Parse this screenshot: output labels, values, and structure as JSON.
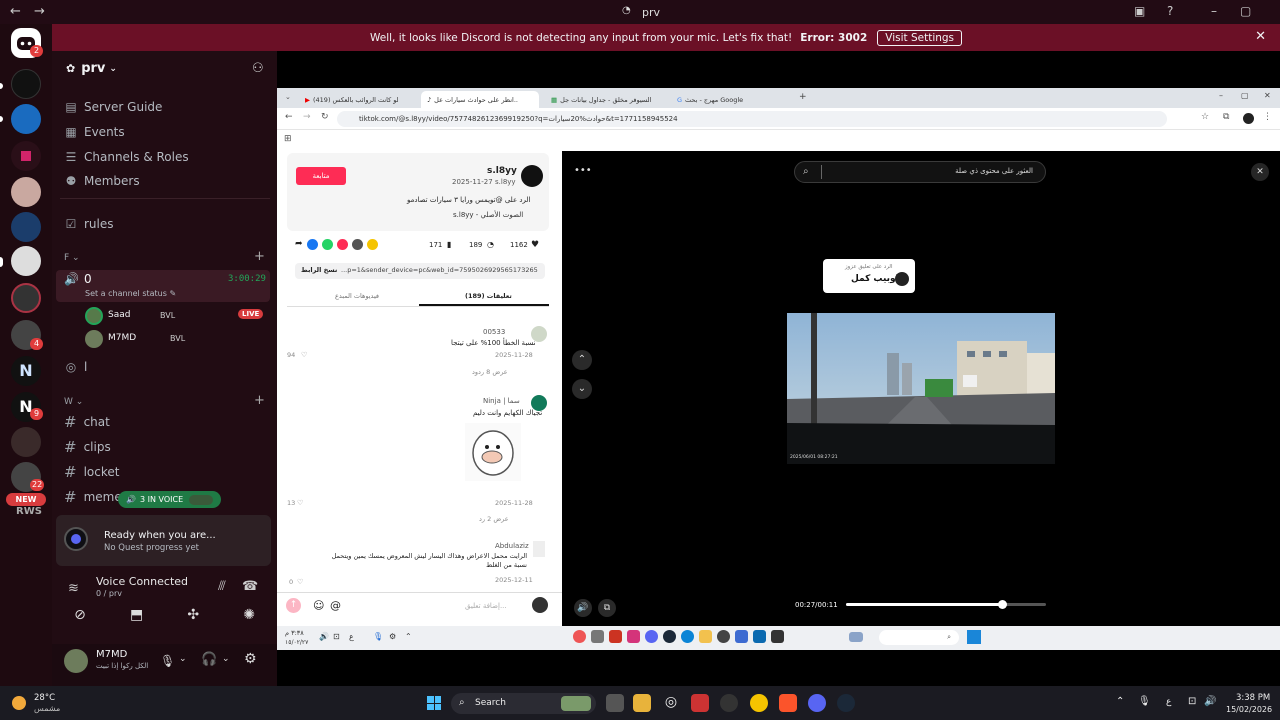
{
  "window": {
    "title": "prv"
  },
  "banner": {
    "text": "Well, it looks like Discord is not detecting any input from your mic. Let's fix that!",
    "error": "Error: 3002",
    "button": "Visit Settings"
  },
  "servers": {
    "home_badge": "2",
    "badges": [
      "4",
      "9",
      "22"
    ],
    "new_label": "NEW",
    "rws": "RWS"
  },
  "server": {
    "name": "prv"
  },
  "nav": [
    "Server Guide",
    "Events",
    "Channels & Roles",
    "Members"
  ],
  "channels": {
    "rules": "rules",
    "cat_f": "F",
    "voice": {
      "name": "0",
      "timer": "3:00:29",
      "status": "Set a channel status",
      "users": [
        {
          "name": "Saad",
          "tag": "BVL",
          "live": "LIVE"
        },
        {
          "name": "M7MD",
          "tag": "BVL"
        }
      ]
    },
    "voice2": "l",
    "cat_w": "W",
    "text": [
      "chat",
      "clips",
      "locket",
      "meme"
    ],
    "in_voice": "3 IN VOICE"
  },
  "quest": {
    "title": "Ready when you are...",
    "sub": "No Quest progress yet"
  },
  "voice_conn": {
    "title": "Voice Connected",
    "sub": "0 / prv"
  },
  "user": {
    "name": "M7MD",
    "status": "الكل ركوا إذا تبيت"
  },
  "browser": {
    "tabs": [
      "(419) لو كانت الروائب بالعكس",
      "انظر على حوادث سيارات عل..",
      "السيوفر مخلق - جداول بيانات جل",
      "مهرج - بحث Google"
    ],
    "url": "tiktok.com/@s.l8yy/video/7577482612369919250?q=حوادث%20سيارات&t=1771158945524"
  },
  "tiktok": {
    "user": "s.l8yy",
    "handle": "s.l8yy",
    "date": "2025-11-27",
    "follow": "متابعة",
    "desc": "الرد على @تويمس ورايا ٣ سيارات تصادمو",
    "sound": "الصوت الأصلي - s.l8yy",
    "likes": "1162",
    "comments_n": "189",
    "saves": "171",
    "link": "...p=1&sender_device=pc&web_id=7595026929565173265",
    "copy": "نسخ الرابط",
    "tab_comments": "تعليقات (189)",
    "tab_creator": "فيديوهات المبدع",
    "comments": [
      {
        "user": "00533",
        "text": "نسبة الخطأ 100% على تيتجا",
        "date": "2025-11-28",
        "likes": "94",
        "replies": "عرض 8 ردود"
      },
      {
        "user": "Ninja | سما",
        "text": "تجياك الكهايم وانت دليم",
        "date": "2025-11-28",
        "likes": "13",
        "replies": "عرض 2 رد"
      },
      {
        "user": "Abdulaziz",
        "text": "الرايت محمل الاعراض وهذاك اليسار ليش المعروض يمسك يمين ويتحمل نسبة من الغلط",
        "date": "2025-12-11",
        "likes": "0"
      }
    ],
    "input_placeholder": "إضافة تعليق..."
  },
  "player": {
    "search": "العثور على محتوى ذي صلة",
    "reply_label": "الرد على تعليق عزوز",
    "reply_text": "اوبيب كمل",
    "time": "00:27/00:11",
    "dashcam": "2025/06/01  08:27:21",
    "progress": 0.78
  },
  "inner_taskbar": {
    "lang": "ع",
    "time": "٣:٣٨ م",
    "date": "١٥/٠٢/٢٧"
  },
  "taskbar": {
    "temp": "28°C",
    "weather": "مشمس",
    "search": "Search",
    "time": "3:38 PM",
    "date": "15/02/2026",
    "lang": "ع"
  }
}
